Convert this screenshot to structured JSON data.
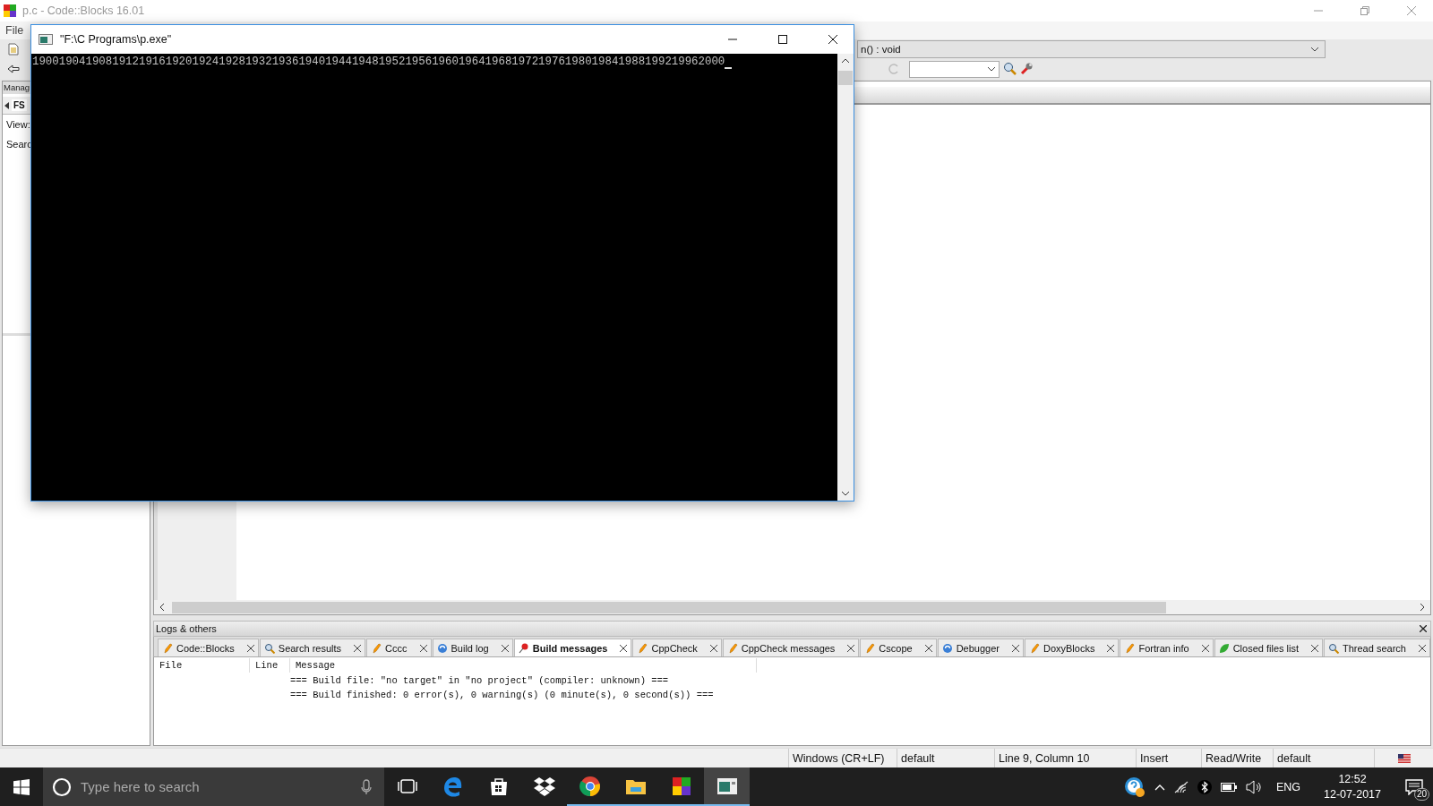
{
  "ide": {
    "title": "p.c - Code::Blocks 16.01",
    "menu": [
      "File"
    ],
    "function_combo": "n() : void",
    "left_panel": {
      "header": "Manag",
      "tab": "FS",
      "view_label": "View:",
      "search_label": "Searc"
    }
  },
  "console": {
    "title": "\"F:\\C Programs\\p.exe\"",
    "output": "19001904190819121916192019241928193219361940194419481952195619601964196819721976198019841988199219962000"
  },
  "logs": {
    "title": "Logs & others",
    "tabs": [
      {
        "label": "Code::Blocks",
        "kind": "pencil",
        "selected": false
      },
      {
        "label": "Search results",
        "kind": "search",
        "selected": false
      },
      {
        "label": "Cccc",
        "kind": "pencil",
        "selected": false
      },
      {
        "label": "Build log",
        "kind": "cycle",
        "selected": false
      },
      {
        "label": "Build messages",
        "kind": "pin",
        "selected": true
      },
      {
        "label": "CppCheck",
        "kind": "pencil",
        "selected": false
      },
      {
        "label": "CppCheck messages",
        "kind": "pencil",
        "selected": false
      },
      {
        "label": "Cscope",
        "kind": "pencil",
        "selected": false
      },
      {
        "label": "Debugger",
        "kind": "cycle",
        "selected": false
      },
      {
        "label": "DoxyBlocks",
        "kind": "pencil",
        "selected": false
      },
      {
        "label": "Fortran info",
        "kind": "pencil",
        "selected": false
      },
      {
        "label": "Closed files list",
        "kind": "leaf",
        "selected": false
      },
      {
        "label": "Thread search",
        "kind": "search",
        "selected": false
      }
    ],
    "columns": [
      "File",
      "Line",
      "Message"
    ],
    "messages": [
      "=== Build file: \"no target\" in \"no project\" (compiler: unknown) ===",
      "=== Build finished: 0 error(s), 0 warning(s) (0 minute(s), 0 second(s)) ==="
    ]
  },
  "status_bar": [
    "Windows (CR+LF)",
    "default",
    "Line 9, Column 10",
    "Insert",
    "Read/Write",
    "default"
  ],
  "taskbar": {
    "search_placeholder": "Type here to search",
    "apps": [
      {
        "kind": "taskview",
        "running": false,
        "selected": false
      },
      {
        "kind": "edge",
        "running": false,
        "selected": false
      },
      {
        "kind": "store",
        "running": false,
        "selected": false
      },
      {
        "kind": "dropbox",
        "running": false,
        "selected": false
      },
      {
        "kind": "chrome",
        "running": true,
        "selected": false
      },
      {
        "kind": "explorer",
        "running": true,
        "selected": false
      },
      {
        "kind": "codeblocks",
        "running": true,
        "selected": false
      },
      {
        "kind": "console",
        "running": true,
        "selected": true
      }
    ],
    "language": "ENG",
    "time": "12:52",
    "date": "12-07-2017",
    "notification_count": "20"
  }
}
